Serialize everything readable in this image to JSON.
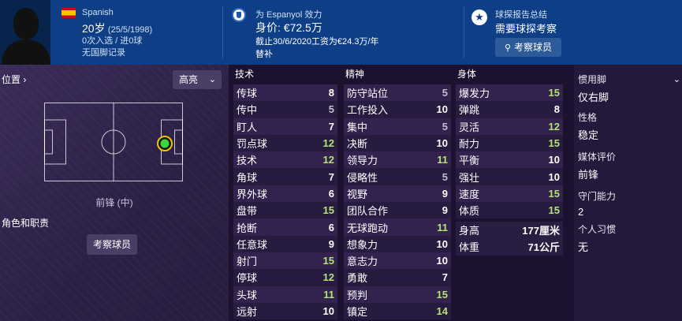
{
  "header": {
    "nationality": "Spanish",
    "age": "20岁",
    "dob": "(25/5/1998)",
    "caps": "0次入选 / 进0球",
    "record": "无国脚记录",
    "club_line": "为 Espanyol 效力",
    "value": "身价: €72.5万",
    "contract": "截止30/6/2020工资为€24.3万/年",
    "status": "替补",
    "scout_title": "球探报告总结",
    "scout_need": "需要球探考察",
    "scout_button": "考察球员"
  },
  "left": {
    "position_title": "位置",
    "dropdown": "高亮",
    "position_label": "前锋 (中)",
    "role_title": "角色和职责",
    "role_button": "考察球员"
  },
  "attributes": {
    "technical_title": "技术",
    "mental_title": "精神",
    "physical_title": "身体",
    "technical": [
      {
        "name": "传球",
        "value": "8",
        "tone": "w"
      },
      {
        "name": "传中",
        "value": "5",
        "tone": "d"
      },
      {
        "name": "盯人",
        "value": "7",
        "tone": "w"
      },
      {
        "name": "罚点球",
        "value": "12",
        "tone": "g"
      },
      {
        "name": "技术",
        "value": "12",
        "tone": "g"
      },
      {
        "name": "角球",
        "value": "7",
        "tone": "w"
      },
      {
        "name": "界外球",
        "value": "6",
        "tone": "w"
      },
      {
        "name": "盘带",
        "value": "15",
        "tone": "g"
      },
      {
        "name": "抢断",
        "value": "6",
        "tone": "w"
      },
      {
        "name": "任意球",
        "value": "9",
        "tone": "w"
      },
      {
        "name": "射门",
        "value": "15",
        "tone": "g"
      },
      {
        "name": "停球",
        "value": "12",
        "tone": "g"
      },
      {
        "name": "头球",
        "value": "11",
        "tone": "g"
      },
      {
        "name": "远射",
        "value": "10",
        "tone": "w"
      }
    ],
    "mental": [
      {
        "name": "防守站位",
        "value": "5",
        "tone": "d"
      },
      {
        "name": "工作投入",
        "value": "10",
        "tone": "w"
      },
      {
        "name": "集中",
        "value": "5",
        "tone": "d"
      },
      {
        "name": "决断",
        "value": "10",
        "tone": "w"
      },
      {
        "name": "领导力",
        "value": "11",
        "tone": "g"
      },
      {
        "name": "侵略性",
        "value": "5",
        "tone": "d"
      },
      {
        "name": "视野",
        "value": "9",
        "tone": "w"
      },
      {
        "name": "团队合作",
        "value": "9",
        "tone": "w"
      },
      {
        "name": "无球跑动",
        "value": "11",
        "tone": "g"
      },
      {
        "name": "想象力",
        "value": "10",
        "tone": "w"
      },
      {
        "name": "意志力",
        "value": "10",
        "tone": "w"
      },
      {
        "name": "勇敢",
        "value": "7",
        "tone": "w"
      },
      {
        "name": "预判",
        "value": "15",
        "tone": "g"
      },
      {
        "name": "镇定",
        "value": "14",
        "tone": "g"
      }
    ],
    "physical": [
      {
        "name": "爆发力",
        "value": "15",
        "tone": "g"
      },
      {
        "name": "弹跳",
        "value": "8",
        "tone": "w"
      },
      {
        "name": "灵活",
        "value": "12",
        "tone": "g"
      },
      {
        "name": "耐力",
        "value": "15",
        "tone": "g"
      },
      {
        "name": "平衡",
        "value": "10",
        "tone": "w"
      },
      {
        "name": "强壮",
        "value": "10",
        "tone": "w"
      },
      {
        "name": "速度",
        "value": "15",
        "tone": "g"
      },
      {
        "name": "体质",
        "value": "15",
        "tone": "g"
      }
    ],
    "height_label": "身高",
    "height_value": "177厘米",
    "weight_label": "体重",
    "weight_value": "71公斤"
  },
  "right": {
    "foot_label": "惯用脚",
    "foot_value": "仅右脚",
    "personality_label": "性格",
    "personality_value": "稳定",
    "media_label": "媒体评价",
    "media_value": "前锋",
    "gk_label": "守门能力",
    "gk_value": "2",
    "habits_label": "个人习惯",
    "habits_value": "无"
  }
}
